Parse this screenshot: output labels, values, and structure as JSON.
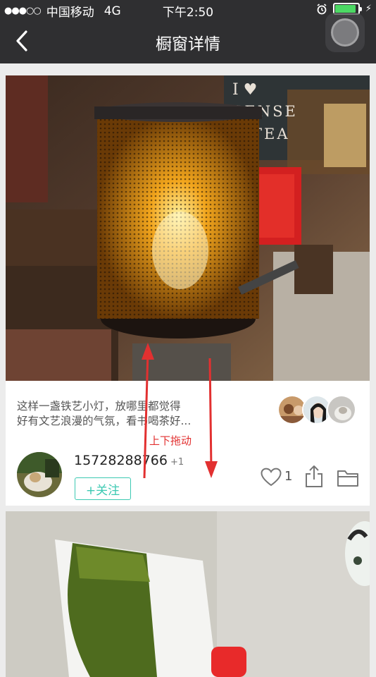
{
  "status_bar": {
    "signal": "●●●○○",
    "carrier": "中国移动",
    "network": "4G",
    "time": "下午2:50",
    "alarm_icon": "alarm-icon",
    "battery_level": 0.9,
    "battery_color": "#4cd964",
    "charging_icon": "lightning-bolt-icon"
  },
  "nav": {
    "back_icon": "chevron-left-icon",
    "title": "橱窗详情"
  },
  "post": {
    "photo_text": {
      "sign_1": "I ♥",
      "sign_2": "SENSE",
      "sign_3": "TEA"
    },
    "description": [
      "这样一盏铁艺小灯，放哪里都觉得",
      "好有文艺浪漫的气氛，看书喝茶好..."
    ],
    "liker_count_shown": 3,
    "author": {
      "name": "15728288766",
      "badge": "+1"
    },
    "follow_label": "+关注",
    "like_count": "1",
    "accent_color": "#3cc9b2"
  },
  "annotation": {
    "drag_label": "上下拖动",
    "color": "#e23030"
  }
}
